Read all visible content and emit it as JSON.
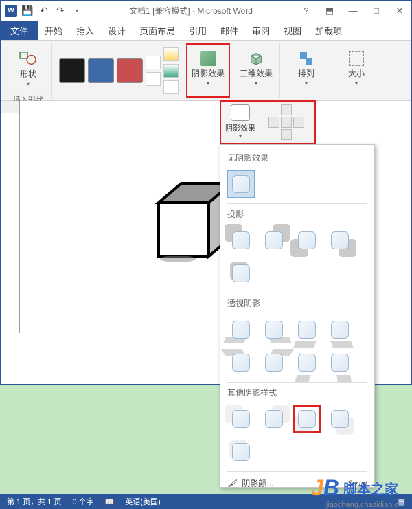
{
  "title": "文档1 [兼容模式] - Microsoft Word",
  "qat": {
    "save": "💾",
    "undo": "↶",
    "redo": "↷"
  },
  "win": {
    "help": "?",
    "opts": "⬒",
    "min": "—",
    "max": "□",
    "close": "✕"
  },
  "menu": {
    "file": "文件",
    "tabs": [
      "开始",
      "插入",
      "设计",
      "页面布局",
      "引用",
      "邮件",
      "审阅",
      "视图",
      "加载项"
    ]
  },
  "ribbon": {
    "shapes": "形状",
    "insert_shape": "插入形状",
    "shadow_effect": "阴影效果",
    "threed_effect": "三维效果",
    "arrange": "排列",
    "size": "大小"
  },
  "sub_ribbon": {
    "shadow_effect": "阴影效果"
  },
  "dropdown": {
    "no_shadow": "无阴影效果",
    "projection": "投影",
    "perspective": "透视阴影",
    "other_styles": "其他阴影样式",
    "shadow_color": "阴影颜..."
  },
  "statusbar": {
    "page": "第 1 页，共 1 页",
    "words": "0 个字",
    "lang": "英语(美国)",
    "script": "Script"
  },
  "watermark": {
    "brand": "脚本之家",
    "url": "jiaocheng.chazidian.c"
  },
  "colors": {
    "black": "#1a1a1a",
    "blue": "#3d6aa8",
    "red": "#c84f4f"
  }
}
